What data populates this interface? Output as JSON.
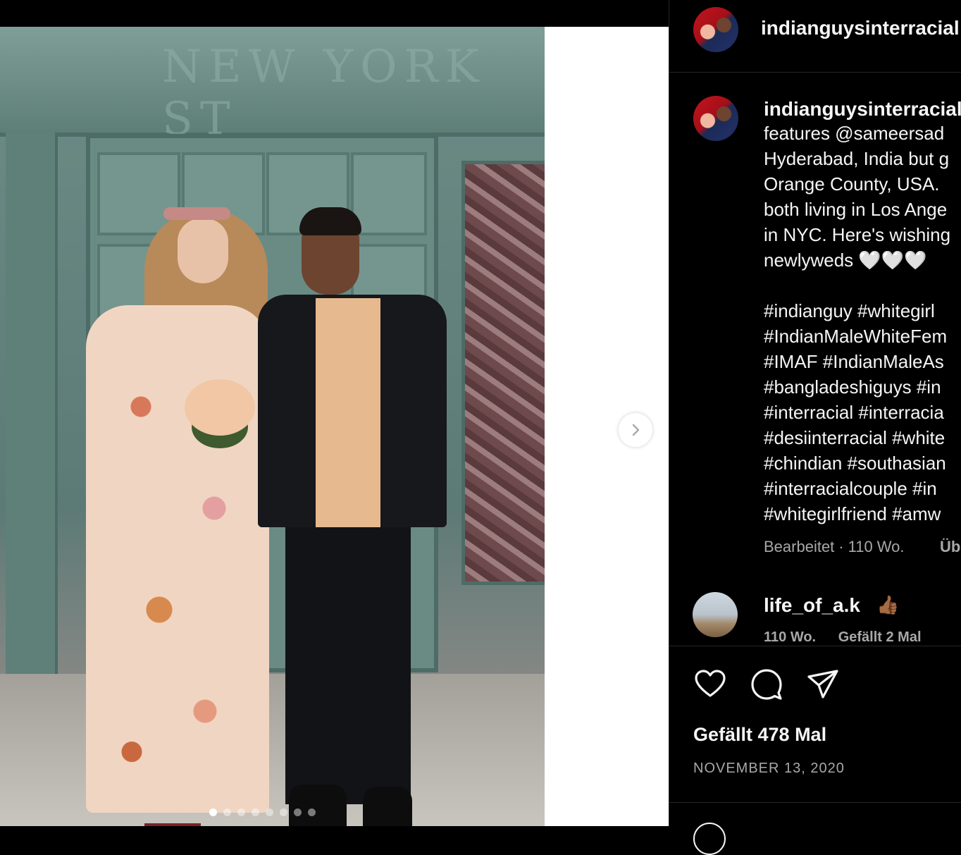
{
  "post": {
    "username": "indianguysinterracial",
    "caption_lines": "features @sameersad\nHyderabad, India but g\nOrange County, USA. \nboth living in Los Ange\nin NYC. Here's wishing\nnewlyweds 🤍🤍🤍",
    "hashtags": "#indianguy #whitegirl\n#IndianMaleWhiteFem\n#IMAF #IndianMaleAs\n#bangladeshiguys #in\n#interracial #interracia\n#desiinterracial #white\n#chindian #southasian\n#interracialcouple #in\n#whitegirlfriend #amw",
    "edited_label": "Bearbeitet",
    "age": "110 Wo.",
    "translate_label": "Üb",
    "likes_text": "Gefällt 478 Mal",
    "date_text": "NOVEMBER 13, 2020"
  },
  "comment": {
    "username": "life_of_a.k",
    "emoji": "👍🏾",
    "age": "110 Wo.",
    "likes": "Gefällt 2 Mal"
  },
  "carousel": {
    "total_slides": 8,
    "active_index": 0
  },
  "icons": {
    "next": "chevron-right-icon",
    "like": "heart-icon",
    "comment": "comment-bubble-icon",
    "share": "paper-plane-icon"
  },
  "photo": {
    "engraved_text": "NEW YORK ST"
  }
}
